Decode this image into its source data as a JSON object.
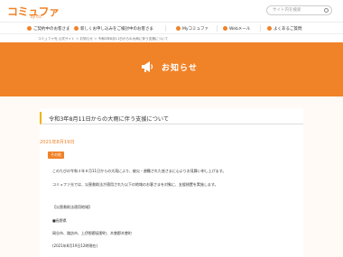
{
  "header": {
    "logo_main": "コミュファ",
    "logo_sub": "by ctc",
    "search_placeholder": "サイト内を検索"
  },
  "nav": {
    "items": [
      "ご契約中のお客さま",
      "新しくお申し込みをご検討中のお客さま",
      "Myコミュファ",
      "Webメール",
      "よくあるご質問"
    ]
  },
  "breadcrumb": "コミュファ光 公式サイト ＞ お知らせ ＞ 令和3年8月11日からの大雨に伴う支援について",
  "hero": {
    "title": "お知らせ"
  },
  "article": {
    "title": "令和3年8月11日からの大雨に伴う支援について",
    "date": "2021年8月19日",
    "category": "その他",
    "para1": "このたびの令和３年８月11日からの大雨により、被災・避難された皆さまに心よりお見舞い申し上げます。",
    "para2": "コミュファ光では、災害救助法が適用された以下の地域のお客さまを対象に、支援措置を実施します。",
    "section_heading": "【災害救助法適用地域】",
    "prefecture": "■長野県",
    "cities": "岡谷市、諏訪市、上伊那郡辰野町、木曽郡木曽町",
    "note": "(2021年8月19日12時現在)"
  },
  "colors": {
    "brand": "#f08228",
    "accent_bar": "#f0b400"
  }
}
